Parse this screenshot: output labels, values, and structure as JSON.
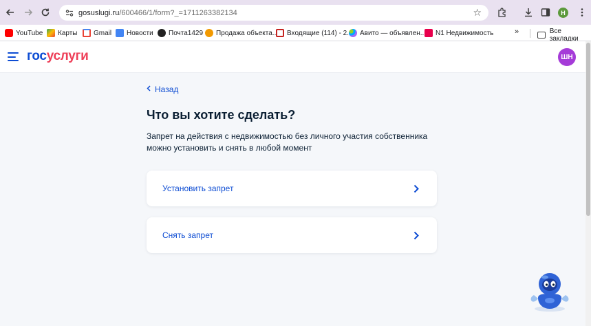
{
  "browser": {
    "url_domain": "gosuslugi.ru",
    "url_path": "/600466/1/form?_=1711263382134",
    "profile_initial": "Н",
    "bookmarks": [
      {
        "label": "YouTube",
        "color": "#ff0000"
      },
      {
        "label": "Карты",
        "color": "#34a853"
      },
      {
        "label": "Gmail",
        "color": "#ea4335"
      },
      {
        "label": "Новости",
        "color": "#4285f4"
      },
      {
        "label": "Почта1429",
        "color": "#222222"
      },
      {
        "label": "Продажа объекта...",
        "color": "#f29900"
      },
      {
        "label": "Входящие (114) - 2...",
        "color": "#c5221f"
      },
      {
        "label": "Авито — объявлен...",
        "color": "#00aaff"
      },
      {
        "label": "N1 Недвижимость",
        "color": "#e8004c"
      }
    ],
    "more_label": "»",
    "all_bookmarks_label": "Все закладки"
  },
  "site": {
    "logo_part1": "гос",
    "logo_part2": "услуги",
    "avatar_initials": "ШН"
  },
  "content": {
    "back_label": "Назад",
    "title": "Что вы хотите сделать?",
    "description": "Запрет на действия с недвижимостью без личного участия собственника можно установить и снять в любой момент",
    "options": [
      {
        "label": "Установить запрет"
      },
      {
        "label": "Снять запрет"
      }
    ]
  },
  "colors": {
    "brand_blue": "#0d4cd3",
    "brand_red": "#ee3f58",
    "avatar": "#a53bd8"
  }
}
